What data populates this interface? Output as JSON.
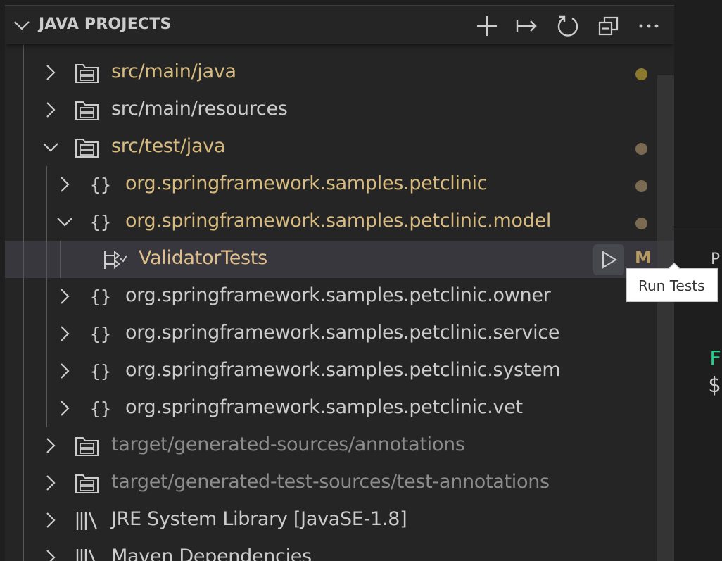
{
  "header": {
    "title": "JAVA PROJECTS",
    "actions": [
      "new-icon",
      "link-icon",
      "refresh-icon",
      "collapse-all-icon",
      "more-icon"
    ]
  },
  "tree": [
    {
      "label": "src/main/java",
      "indent": 0,
      "expanded": false,
      "icon": "package-folder-icon",
      "color": "#d7ba7d",
      "decoration": "dot",
      "decoration_color": "#8b7a2d"
    },
    {
      "label": "src/main/resources",
      "indent": 0,
      "expanded": false,
      "icon": "package-folder-icon",
      "color": "#cccccc",
      "decoration": "none"
    },
    {
      "label": "src/test/java",
      "indent": 0,
      "expanded": true,
      "icon": "package-folder-icon",
      "color": "#d7ba7d",
      "decoration": "dot",
      "decoration_color": "#7a6a52"
    },
    {
      "label": "org.springframework.samples.petclinic",
      "indent": 1,
      "expanded": false,
      "icon": "package-icon",
      "color": "#d7ba7d",
      "decoration": "dot",
      "decoration_color": "#7a6a52"
    },
    {
      "label": "org.springframework.samples.petclinic.model",
      "indent": 1,
      "expanded": true,
      "icon": "package-icon",
      "color": "#d7ba7d",
      "decoration": "dot",
      "decoration_color": "#7a6a52"
    },
    {
      "label": "ValidatorTests",
      "indent": 2,
      "expanded": null,
      "icon": "test-class-icon",
      "color": "#e2c08d",
      "decoration": "M",
      "selected": true
    },
    {
      "label": "org.springframework.samples.petclinic.owner",
      "indent": 1,
      "expanded": false,
      "icon": "package-icon",
      "color": "#cccccc",
      "decoration": "none"
    },
    {
      "label": "org.springframework.samples.petclinic.service",
      "indent": 1,
      "expanded": false,
      "icon": "package-icon",
      "color": "#cccccc",
      "decoration": "none"
    },
    {
      "label": "org.springframework.samples.petclinic.system",
      "indent": 1,
      "expanded": false,
      "icon": "package-icon",
      "color": "#cccccc",
      "decoration": "none"
    },
    {
      "label": "org.springframework.samples.petclinic.vet",
      "indent": 1,
      "expanded": false,
      "icon": "package-icon",
      "color": "#cccccc",
      "decoration": "none"
    },
    {
      "label": "target/generated-sources/annotations",
      "indent": 0,
      "expanded": false,
      "icon": "package-folder-icon",
      "color": "#8c8c8c",
      "decoration": "none"
    },
    {
      "label": "target/generated-test-sources/test-annotations",
      "indent": 0,
      "expanded": false,
      "icon": "package-folder-icon",
      "color": "#8c8c8c",
      "decoration": "none"
    },
    {
      "label": "JRE System Library [JavaSE-1.8]",
      "indent": 0,
      "expanded": false,
      "icon": "library-icon",
      "color": "#cccccc",
      "decoration": "none"
    },
    {
      "label": "Maven Dependencies",
      "indent": 0,
      "expanded": false,
      "icon": "library-icon",
      "color": "#cccccc",
      "decoration": "none"
    }
  ],
  "selected_row": {
    "run_button_icon": "play-icon",
    "badge": "M"
  },
  "tooltip": {
    "text": "Run Tests"
  },
  "right_pane": {
    "panel_char": "P",
    "term_line1": "F",
    "term_line2": "$"
  },
  "colors": {
    "sidebar_bg": "#252526",
    "selected_bg": "#37373d",
    "modified": "#e2c08d",
    "ignored": "#8c8c8c",
    "terminal_green": "#23d18b"
  }
}
